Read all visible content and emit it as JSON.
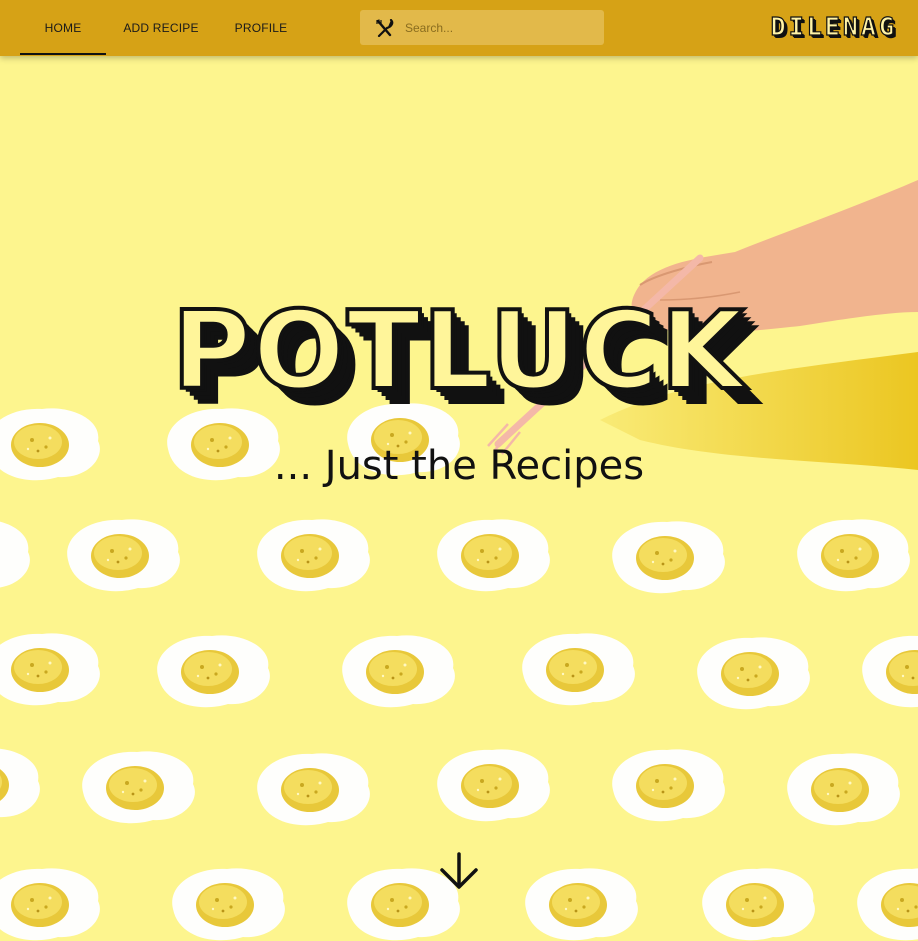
{
  "nav": {
    "tabs": [
      {
        "label": "HOME",
        "active": true
      },
      {
        "label": "ADD RECIPE",
        "active": false
      },
      {
        "label": "PROFILE",
        "active": false
      }
    ],
    "search": {
      "placeholder": "Search...",
      "icon": "utensils-icon"
    },
    "brand": "DILENAG"
  },
  "hero": {
    "title": "POTLUCK",
    "subtitle": "... Just the Recipes",
    "scroll_icon": "arrow-down-icon"
  },
  "colors": {
    "navbar": "#d6a216",
    "background": "#fdf58e",
    "text": "#111111"
  }
}
